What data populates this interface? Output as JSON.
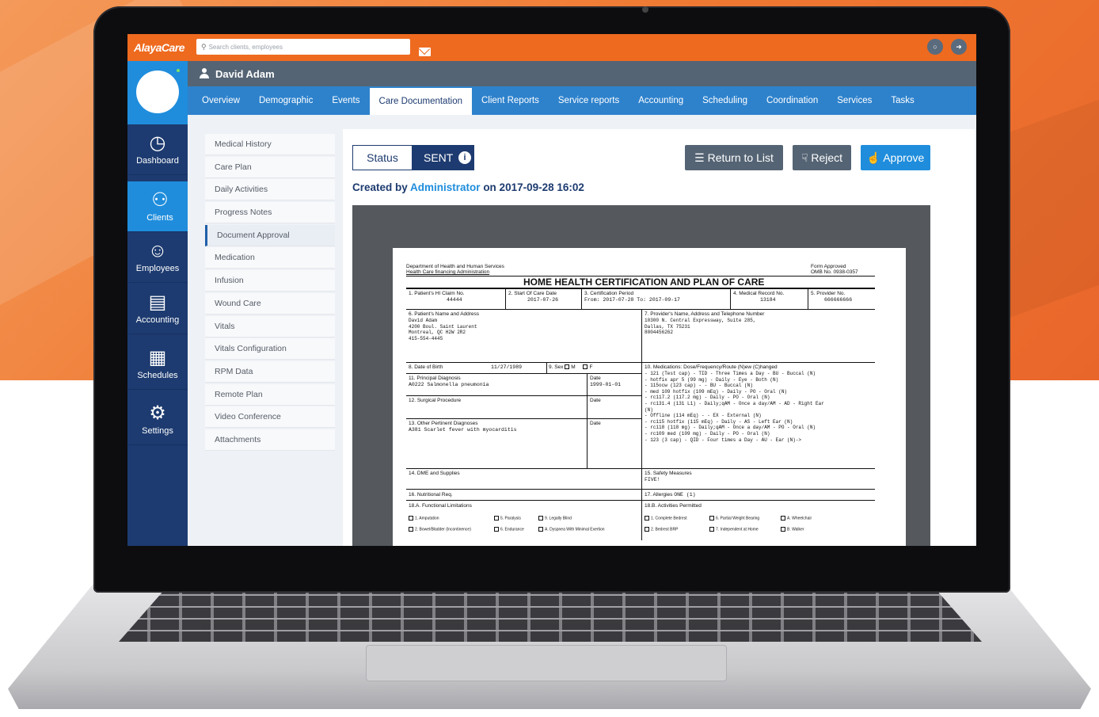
{
  "app": {
    "logo": "AlayaCare",
    "search_placeholder": "Search clients, employees",
    "user_name": "David Adam"
  },
  "left_nav": [
    {
      "label": "Dashboard",
      "icon": "dashboard-icon"
    },
    {
      "label": "Clients",
      "icon": "clients-icon"
    },
    {
      "label": "Employees",
      "icon": "employees-icon"
    },
    {
      "label": "Accounting",
      "icon": "accounting-icon"
    },
    {
      "label": "Schedules",
      "icon": "calendar-icon"
    },
    {
      "label": "Settings",
      "icon": "gear-icon"
    }
  ],
  "tabs": [
    "Overview",
    "Demographic",
    "Events",
    "Care Documentation",
    "Client Reports",
    "Service reports",
    "Accounting",
    "Scheduling",
    "Coordination",
    "Services",
    "Tasks"
  ],
  "submenu": [
    "Medical History",
    "Care Plan",
    "Daily Activities",
    "Progress Notes",
    "Document Approval",
    "Medication",
    "Infusion",
    "Wound Care",
    "Vitals",
    "Vitals Configuration",
    "RPM Data",
    "Remote Plan",
    "Video Conference",
    "Attachments"
  ],
  "panel": {
    "status_label": "Status",
    "status_value": "SENT",
    "return_label": "Return to List",
    "reject_label": "Reject",
    "approve_label": "Approve",
    "created_prefix": "Created by",
    "created_author": "Administrator",
    "created_suffix": "on 2017-09-28 16:02"
  },
  "document": {
    "dept1": "Department of Health and Human Services",
    "dept2": "Health Care financing Administration",
    "form1": "Form Approved",
    "form2": "OMB No. 0938-0357",
    "title": "HOME HEALTH CERTIFICATION AND PLAN OF CARE",
    "f1_label": "1. Patient's HI Claim No.",
    "f1_value": "44444",
    "f2_label": "2. Start Of Care Date",
    "f2_value": "2017-07-26",
    "f3_label": "3. Certification Period",
    "f3_value": "From:     2017-07-28 To:      2017-09-17",
    "f4_label": "4. Medical Record No.",
    "f4_value": "13184",
    "f5_label": "5. Provider No.",
    "f5_value": "666666666",
    "f6_label": "6. Patient's Name and Address",
    "f6_value": "David Adam\n4200 Boul. Saint Laurent\nMontreal, QC H2W 2R2\n415-554-4445",
    "f7_label": "7. Provider's Name, Address and Telephone Number",
    "f7_value": "10300 N. Central Expressway, Suite 285,\nDallas, TX 75231\n8004456262",
    "f8_label": "8. Date of Birth",
    "f8_value": "11/27/1989",
    "f9_label": "9. Sex",
    "f9_m": "M",
    "f9_f": "F",
    "f10_label": "10. Medications: Dose/Frequency/Route (N)ew (C)hanged",
    "f10_value": "- 121 (Test cap) - TID - Three Times a Day - BU - Buccal (N)\n- hotfix apr 5 (99 mg) - Daily - Eye - Both (N)\n- 115ocw (123 cap) - - BU - Buccal (N)\n- med 109 hotfix (109 mEq) - Daily - PO - Oral (N)\n- rc117.2 (117.2 mg) - Daily - PO - Oral (N)\n- rc131.4 (131 L1) - Daily;qAM - Once a day/AM - AD - Right Ear\n(N)\n- Offline (114 mEq) - - EX - External (N)\n- rc115 hotfix (115 mEq) - Daily - AS - Left Ear (N)\n- rc118 (118 mg) - Daily;qAM - Once a day/AM - PO - Oral (N)\n- rc109 med (109 mg) - Daily - PO - Oral (N)\n- 123 (3 cap) - QID - Four times a Day - AU - Ear (N)->",
    "f11_label": "11. Principal Diagnosis",
    "f11_value": "A0222 Salmonella pneumonia",
    "f11_date_label": "Date",
    "f11_date": "1999-01-01",
    "f12_label": "12. Surgical Procedure",
    "f12_date_label": "Date",
    "f13_label": "13. Other Pertinent Diagnoses",
    "f13_value": "A381 Scarlet fever with myocarditis",
    "f13_date_label": "Date",
    "f14_label": "14. DME and Supplies",
    "f15_label": "15. Safety Measures",
    "f15_value": "FIVE!",
    "f16_label": "16. Nutritional Req.",
    "f17_label": "17. Allergies",
    "f17_value": "ONE (1)",
    "f18a_label": "18.A. Functional Limitations",
    "f18b_label": "18.B. Activities Permitted",
    "f18a_row1": [
      "1. Amputation",
      "5. Paralysis",
      "9. Legally Blind"
    ],
    "f18a_row2": [
      "2. Bowel/Bladder (Incontinence)",
      "6. Endurance",
      "A. Dyspnea With Minimal Exertion"
    ],
    "f18b_row1": [
      "1. Complete Bedrest",
      "6. Partial Weight Bearing",
      "A. Wheelchair"
    ],
    "f18b_row2": [
      "2. Bedrest BRP",
      "7. Independent at Home",
      "B. Walker"
    ]
  }
}
